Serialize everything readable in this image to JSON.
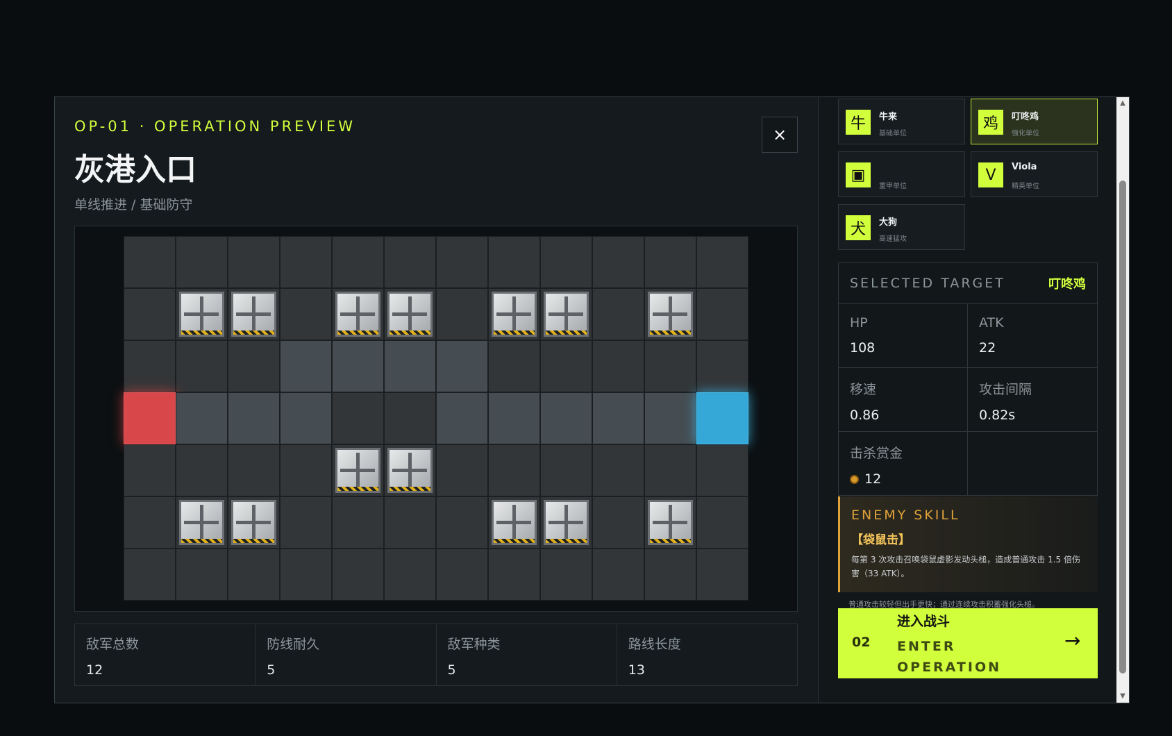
{
  "header": {
    "op_code": "OP-01 · OPERATION PREVIEW",
    "title": "灰港入口",
    "subtitle": "单线推进 / 基础防守",
    "close_label": "×"
  },
  "map": {
    "cols": 12,
    "rows": 7,
    "spawn": [
      3,
      0
    ],
    "goal": [
      3,
      11
    ],
    "path": [
      [
        2,
        3
      ],
      [
        2,
        4
      ],
      [
        2,
        5
      ],
      [
        2,
        6
      ],
      [
        3,
        1
      ],
      [
        3,
        2
      ],
      [
        3,
        3
      ],
      [
        3,
        6
      ],
      [
        3,
        7
      ],
      [
        3,
        8
      ],
      [
        3,
        9
      ],
      [
        3,
        10
      ]
    ],
    "crates": [
      [
        1,
        1
      ],
      [
        1,
        2
      ],
      [
        1,
        4
      ],
      [
        1,
        5
      ],
      [
        1,
        7
      ],
      [
        1,
        8
      ],
      [
        1,
        10
      ],
      [
        4,
        4
      ],
      [
        4,
        5
      ],
      [
        5,
        1
      ],
      [
        5,
        2
      ],
      [
        5,
        7
      ],
      [
        5,
        8
      ],
      [
        5,
        10
      ]
    ]
  },
  "stats": [
    {
      "label": "敌军总数",
      "value": "12"
    },
    {
      "label": "防线耐久",
      "value": "5"
    },
    {
      "label": "敌军种类",
      "value": "5"
    },
    {
      "label": "路线长度",
      "value": "13"
    }
  ],
  "enemies": [
    {
      "icon": "牛",
      "name": "牛来",
      "type": "基础单位",
      "selected": false
    },
    {
      "icon": "鸡",
      "name": "叮咚鸡",
      "type": "强化单位",
      "selected": true
    },
    {
      "icon": "▣",
      "name": "",
      "type": "重甲单位",
      "selected": false
    },
    {
      "icon": "V",
      "name": "Viola",
      "type": "精英单位",
      "selected": false
    },
    {
      "icon": "犬",
      "name": "大狗",
      "type": "高速猛攻",
      "selected": false
    }
  ],
  "target": {
    "title": "SELECTED TARGET",
    "name": "叮咚鸡",
    "attrs": [
      {
        "label": "HP",
        "value": "108"
      },
      {
        "label": "ATK",
        "value": "22"
      },
      {
        "label": "移速",
        "value": "0.86"
      },
      {
        "label": "攻击间隔",
        "value": "0.82s"
      },
      {
        "label": "击杀赏金",
        "value": "12"
      }
    ]
  },
  "skill": {
    "title": "ENEMY SKILL",
    "name": "【袋鼠击】",
    "desc": "每第 3 次攻击召唤袋鼠虚影发动头槌，造成普通攻击 1.5 倍伤害（33 ATK）。",
    "extra": "普通攻击较轻但出手更快；通过连续攻击积蓄强化头槌。"
  },
  "enter": {
    "num": "02",
    "cn": "进入战斗",
    "en": "ENTER OPERATION",
    "arrow": "→"
  },
  "colors": {
    "accent": "#d2ff3c",
    "spawn": "#d8474a",
    "goal": "#35a8d8",
    "skill": "#e0a23a"
  }
}
